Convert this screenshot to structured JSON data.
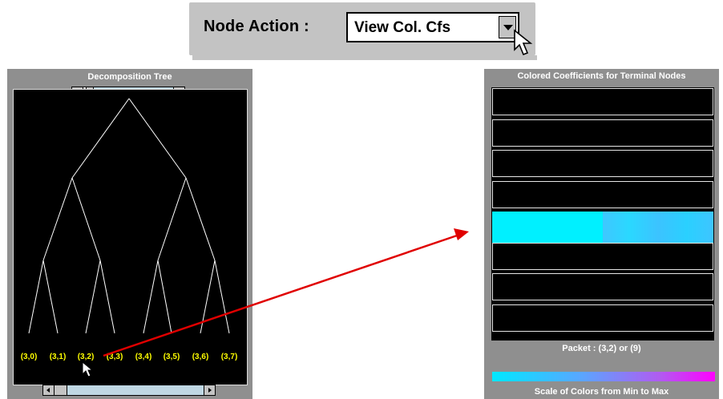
{
  "node_action": {
    "label": "Node Action :",
    "selected": "View Col. Cfs"
  },
  "tree_panel": {
    "title": "Decomposition Tree",
    "terminal_nodes": [
      "(3,0)",
      "(3,1)",
      "(3,2)",
      "(3,3)",
      "(3,4)",
      "(3,5)",
      "(3,6)",
      "(3,7)"
    ]
  },
  "coef_panel": {
    "title": "Colored Coefficients for Terminal Nodes",
    "packet_label": "Packet : (3,2) or (9)",
    "scale_label": "Scale of Colors from Min to Max",
    "highlighted_row": 4,
    "row_count": 8
  },
  "colors": {
    "panel_bg": "#8f8f8f",
    "canvas_bg": "#000000",
    "node_label": "#ffff00",
    "tree_line": "#ffffff",
    "arrow": "#e00000",
    "highlight_cyan": "#00f0ff",
    "scale_min": "#00e8ff",
    "scale_max": "#ff00ff"
  }
}
